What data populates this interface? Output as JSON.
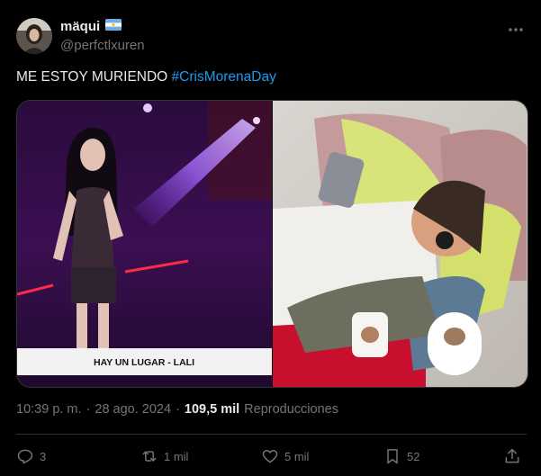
{
  "author": {
    "display_name": "mäqui",
    "handle": "@perfctlxuren",
    "flag_icon": "argentina-flag-icon"
  },
  "tweet": {
    "text": "ME ESTOY MURIENDO",
    "hashtag": "#CrisMorenaDay"
  },
  "media": {
    "left_caption": "HAY UN LUGAR - LALI"
  },
  "meta": {
    "time": "10:39 p. m.",
    "separator": "·",
    "date": "28 ago. 2024",
    "views_count": "109,5 mil",
    "views_label": "Reproducciones"
  },
  "actions": {
    "replies": "3",
    "reposts": "1 mil",
    "likes": "5 mil",
    "bookmarks": "52"
  },
  "colors": {
    "background": "#000000",
    "text": "#e7e9ea",
    "muted": "#71767b",
    "accent": "#1d9bf0",
    "border": "#2f3336"
  }
}
